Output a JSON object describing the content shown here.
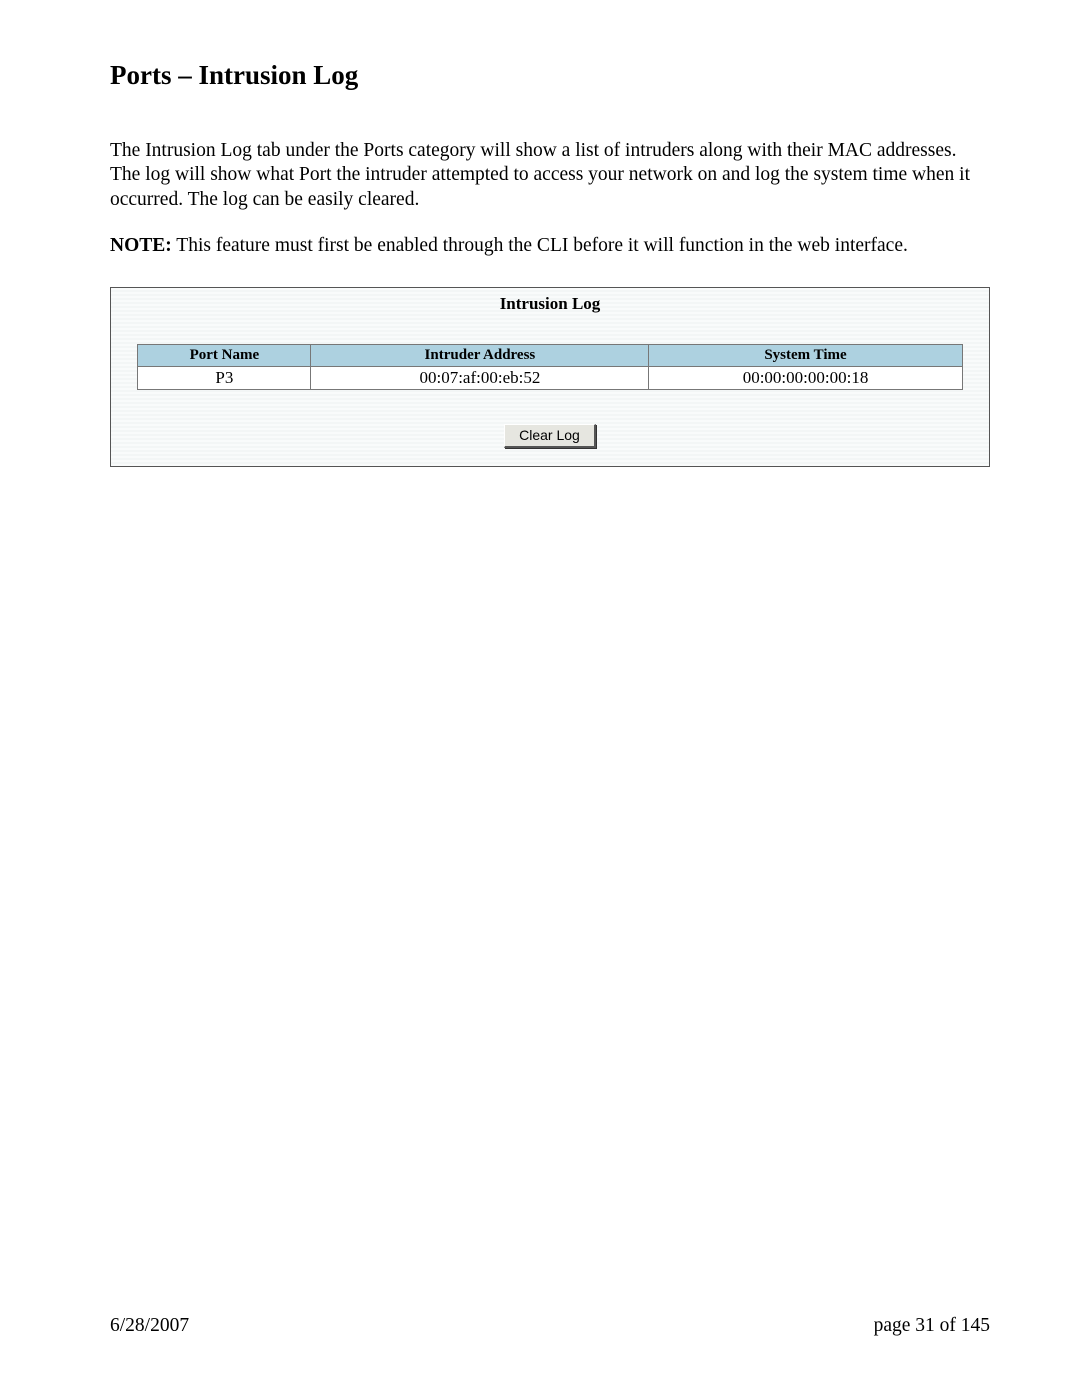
{
  "page_title": "Ports – Intrusion Log",
  "body_paragraph": "The Intrusion Log tab under the Ports category will show a list of intruders along with their MAC addresses. The log will show what Port the intruder attempted to access your network on and log the system time when it occurred.  The log can be easily cleared.",
  "note_label": "NOTE:",
  "note_text": " This feature must first be enabled through the CLI before it will function in the web interface.",
  "panel": {
    "title": "Intrusion Log",
    "columns": {
      "port_name": "Port Name",
      "intruder_address": "Intruder Address",
      "system_time": "System Time"
    },
    "rows": [
      {
        "port_name": "P3",
        "intruder_address": "00:07:af:00:eb:52",
        "system_time": "00:00:00:00:00:18"
      }
    ],
    "clear_button": "Clear Log"
  },
  "footer": {
    "date": "6/28/2007",
    "page_info": "page 31 of 145"
  }
}
